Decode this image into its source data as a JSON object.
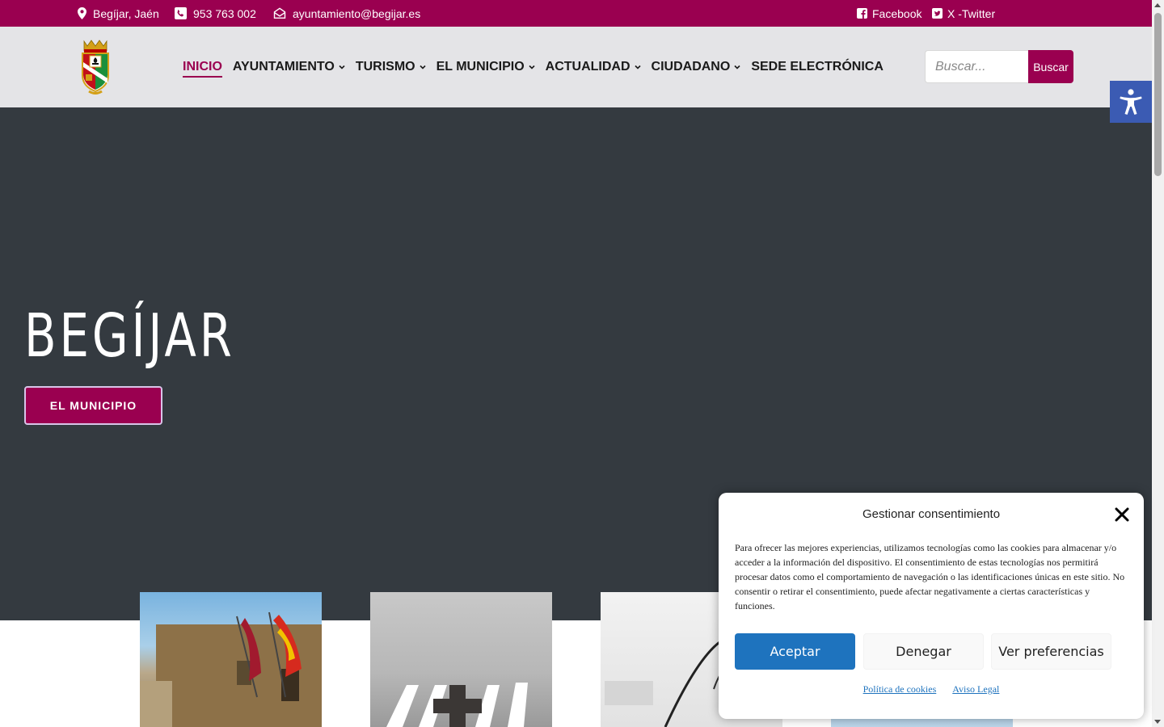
{
  "topbar": {
    "location": "Begíjar, Jaén",
    "phone": "953 763 002",
    "email": "ayuntamiento@begijar.es",
    "facebook": "Facebook",
    "twitter": "X -Twitter"
  },
  "nav": {
    "items": [
      {
        "label": "INICIO",
        "active": true,
        "has_dropdown": false
      },
      {
        "label": "AYUNTAMIENTO",
        "has_dropdown": true
      },
      {
        "label": "TURISMO",
        "has_dropdown": true
      },
      {
        "label": "EL MUNICIPIO",
        "has_dropdown": true
      },
      {
        "label": "ACTUALIDAD",
        "has_dropdown": true
      },
      {
        "label": "CIUDADANO",
        "has_dropdown": true
      },
      {
        "label": "SEDE ELECTRÓNICA",
        "has_dropdown": false
      }
    ]
  },
  "search": {
    "placeholder": "Buscar...",
    "button_label": "Buscar"
  },
  "hero": {
    "title": "BEGÍJAR",
    "button_label": "EL MUNICIPIO"
  },
  "cookie_modal": {
    "title": "Gestionar consentimiento",
    "text": "Para ofrecer las mejores experiencias, utilizamos tecnologías como las cookies para almacenar y/o acceder a la información del dispositivo. El consentimiento de estas tecnologías nos permitirá procesar datos como el comportamiento de navegación o las identificaciones únicas en este sitio. No consentir o retirar el consentimiento, puede afectar negativamente a ciertas características y funciones.",
    "accept_label": "Aceptar",
    "deny_label": "Denegar",
    "prefs_label": "Ver preferencias",
    "cookies_link": "Política de cookies",
    "legal_link": "Aviso Legal"
  },
  "colors": {
    "brand": "#9a0050",
    "header_bg": "#e4e4e7",
    "hero_bg": "#343a40",
    "accept_blue": "#1e73be",
    "a11y_blue": "#3b5bb3"
  },
  "icons": [
    "map-pin-icon",
    "phone-icon",
    "envelope-icon",
    "facebook-icon",
    "twitter-icon",
    "chevron-down-icon",
    "accessibility-icon",
    "close-icon"
  ]
}
